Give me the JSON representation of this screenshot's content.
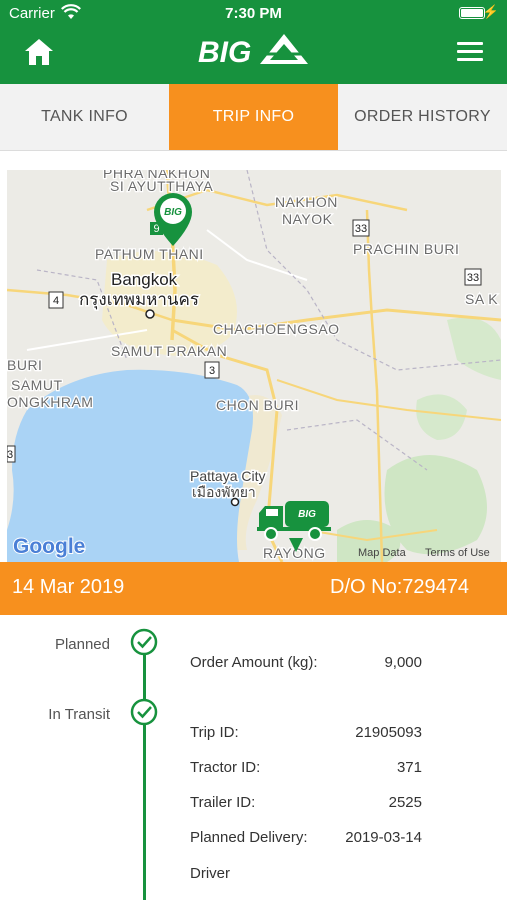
{
  "status_bar": {
    "carrier": "Carrier",
    "time": "7:30 PM"
  },
  "header": {
    "logo_text": "BIG"
  },
  "tabs": [
    {
      "label": "TANK INFO",
      "active": false
    },
    {
      "label": "TRIP INFO",
      "active": true
    },
    {
      "label": "ORDER HISTORY",
      "active": false
    }
  ],
  "map": {
    "labels": {
      "phra_nakhon": "PHRA NAKHON",
      "si_ayutthaya": "SI AYUTTHAYA",
      "nakhon": "NAKHON",
      "nayok": "NAYOK",
      "pathum_thani": "PATHUM THANI",
      "prachin_buri": "PRACHIN BURI",
      "bangkok": "Bangkok",
      "bangkok_thai": "กรุงเทพมหานคร",
      "chachoengsao": "CHACHOENGSAO",
      "samut_prakan": "SAMUT PRAKAN",
      "sa_k": "SA K",
      "buri": "BURI",
      "samut": "SAMUT",
      "ongkhram": "ONGKHRAM",
      "chon_buri": "CHON BURI",
      "pattaya": "Pattaya City",
      "pattaya_thai": "เมืองพัทยา",
      "rayong": "RAYONG"
    },
    "route_shields": [
      "9",
      "33",
      "4",
      "3",
      "33",
      "3"
    ],
    "attribution": {
      "google": "Google",
      "map_data": "Map Data",
      "terms": "Terms of Use"
    },
    "pin_logo": "BIG",
    "truck_logo": "BIG"
  },
  "order": {
    "date": "14 Mar 2019",
    "do_number": "D/O No:729474"
  },
  "timeline": [
    {
      "label": "Planned",
      "done": true
    },
    {
      "label": "In Transit",
      "done": true
    }
  ],
  "details": [
    {
      "key": "Order Amount (kg):",
      "value": "9,000"
    },
    {
      "key": "Trip ID:",
      "value": "21905093"
    },
    {
      "key": "Tractor ID:",
      "value": "371"
    },
    {
      "key": "Trailer ID:",
      "value": "2525"
    },
    {
      "key": "Planned Delivery:",
      "value": "2019-03-14"
    },
    {
      "key": "Driver",
      "value": ""
    }
  ],
  "colors": {
    "brand_green": "#17923e",
    "accent_orange": "#f7901e",
    "water": "#aad3f5",
    "highway": "#f7d67a"
  }
}
